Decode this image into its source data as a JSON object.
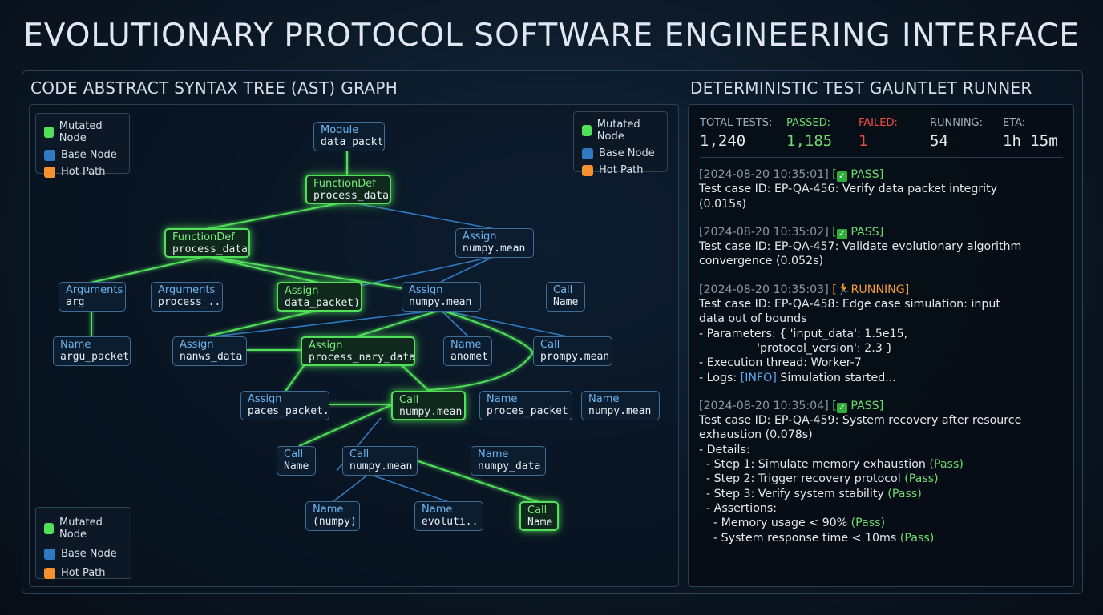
{
  "title": "EVOLUTIONARY PROTOCOL SOFTWARE ENGINEERING INTERFACE",
  "colors": {
    "mutated": "#52e05a",
    "base": "#2f7ac2",
    "hot": "#f5922f"
  },
  "ast_panel": {
    "title": "CODE ABSTRACT SYNTAX TREE (AST) GRAPH",
    "legend": {
      "mutated": "Mutated Node",
      "base": "Base Node",
      "hot": "Hot Path"
    },
    "nodes": {
      "module": {
        "type": "Module",
        "value": "data_packt"
      },
      "funcdef_root": {
        "type": "FunctionDef",
        "value": "process_data"
      },
      "funcdef_child": {
        "type": "FunctionDef",
        "value": "process_data"
      },
      "assign_mean1": {
        "type": "Assign",
        "value": "numpy.mean"
      },
      "args_arg": {
        "type": "Arguments",
        "value": "arg"
      },
      "args_process": {
        "type": "Arguments",
        "value": "process_.."
      },
      "assign_data_packet": {
        "type": "Assign",
        "value": "data_packet)"
      },
      "assign_mean2": {
        "type": "Assign",
        "value": "numpy.mean"
      },
      "call_name1": {
        "type": "Call",
        "value": "Name"
      },
      "name_argu": {
        "type": "Name",
        "value": "argu_packet"
      },
      "assign_nanws": {
        "type": "Assign",
        "value": "nanws_data"
      },
      "assign_nary": {
        "type": "Assign",
        "value": "process_nary_data"
      },
      "name_anomet": {
        "type": "Name",
        "value": "anomet"
      },
      "call_prompy": {
        "type": "Call",
        "value": "prompy.mean"
      },
      "assign_paces": {
        "type": "Assign",
        "value": "paces_packet."
      },
      "call_mean1": {
        "type": "Call",
        "value": "numpy.mean"
      },
      "name_proces": {
        "type": "Name",
        "value": "proces_packet"
      },
      "name_mean": {
        "type": "Name",
        "value": "numpy.mean"
      },
      "call_name2": {
        "type": "Call",
        "value": "Name"
      },
      "call_mean2": {
        "type": "Call",
        "value": "numpy.mean"
      },
      "name_numpy_data": {
        "type": "Name",
        "value": "numpy_data"
      },
      "name_numpy": {
        "type": "Name",
        "value": "(numpy)"
      },
      "name_evoluti": {
        "type": "Name",
        "value": "evoluti.."
      },
      "call_name3": {
        "type": "Call",
        "value": "Name"
      }
    }
  },
  "test_panel": {
    "title": "DETERMINISTIC TEST GAUNTLET RUNNER",
    "stats": {
      "total": {
        "label": "TOTAL TESTS:",
        "value": "1,240"
      },
      "passed": {
        "label": "PASSED:",
        "value": "1,185"
      },
      "failed": {
        "label": "FAILED:",
        "value": "1"
      },
      "running": {
        "label": "RUNNING:",
        "value": "54"
      },
      "eta": {
        "label": "ETA:",
        "value": "1h 15m"
      }
    },
    "log": {
      "e1": {
        "ts": "[2024-08-20 10:35:01]",
        "status": "PASS",
        "line1": "Test case ID: EP-QA-456: Verify data packet integrity",
        "line2": "(0.015s)"
      },
      "e2": {
        "ts": "[2024-08-20 10:35:02]",
        "status": "PASS",
        "line1": "Test case ID: EP-QA-457: Validate evolutionary algorithm",
        "line2": "convergence (0.052s)"
      },
      "e3": {
        "ts": "[2024-08-20 10:35:03]",
        "status": "RUNNING]",
        "line1": "Test case ID: EP-QA-458: Edge case simulation: input",
        "line2": "data out of bounds",
        "line3": "- Parameters: { 'input_data': 1.5e15,",
        "line4": "                'protocol_version': 2.3 }",
        "line5": "- Execution thread: Worker-7",
        "line6_prefix": "- Logs: ",
        "line6_info": "[INFO]",
        "line6_rest": " Simulation started..."
      },
      "e4": {
        "ts": "[2024-08-20 10:35:04]",
        "status": "PASS",
        "line1": "Test case ID: EP-QA-459: System recovery after resource",
        "line2": "exhaustion (0.078s)",
        "line3": "- Details:",
        "step1": "  - Step 1: Simulate memory exhaustion ",
        "step2": "  - Step 2: Trigger recovery protocol ",
        "step3": "  - Step 3: Verify system stability ",
        "assertions": "  - Assertions:",
        "a1": "    - Memory usage < 90% ",
        "a2": "    - System response time < 10ms ",
        "pass_tag": "(Pass)"
      }
    }
  }
}
